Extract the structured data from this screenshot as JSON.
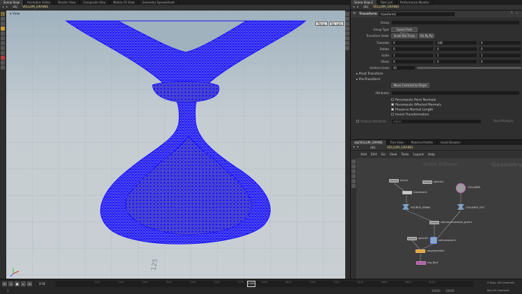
{
  "viewer": {
    "tabs": [
      "Scene View",
      "Animation Editor",
      "Render View",
      "Composite View",
      "Motion FX View",
      "Geometry Spreadsheet"
    ],
    "path": [
      "obj",
      "VELLUM_GRAINS"
    ],
    "view_label": "View",
    "camera_btn": "Persp",
    "cam_btn": "No cam"
  },
  "params": {
    "tabs": [
      "Scene View 2",
      "Take List",
      "Performance Monitor"
    ],
    "path": [
      "obj",
      "VELLUM_GRAINS"
    ],
    "node_type": "Transform",
    "node_name": "transform1",
    "rows": {
      "group_label": "Group",
      "group_type_label": "Group Type",
      "group_type_value": "Guess from Group",
      "xform_order_label": "Transform Order",
      "xform_order_value": "Scale Rot Trans",
      "rot_order_value": "Rx Ry Rz",
      "translate_label": "Translate",
      "translate": [
        "0",
        "148",
        "0"
      ],
      "rotate_label": "Rotate",
      "rotate": [
        "0",
        "0",
        "0"
      ],
      "scale_label": "Scale",
      "scale": [
        "1",
        "1",
        "1"
      ],
      "shear_label": "Shear",
      "shear": [
        "0",
        "0",
        "0"
      ],
      "uniform_label": "Uniform Scale",
      "uniform": "45",
      "pivot_transform": "Pivot Transform",
      "pre_transform": "Pre-Transform",
      "move_centroid_btn": "Move Centroid to Origin",
      "attributes_label": "Attributes",
      "recompute_normals": "Recompute Point Normals",
      "recompute_affected": "Recompute Affected Normals",
      "preserve_normal": "Preserve Normal Length",
      "invert": "Invert Transformation",
      "output_attr_label": "Output Attribute",
      "output_attr_value": "xform",
      "post_multiply": "Post-Multiply"
    }
  },
  "network": {
    "tabs": [
      "obj/VELLUM_GRAINS",
      "Tree View",
      "Material Palette",
      "Asset Browser"
    ],
    "path": [
      "obj",
      "VELLUM_GRAINS"
    ],
    "menu": [
      "Add",
      "Edit",
      "Go",
      "View",
      "Tools",
      "Layout",
      "Help"
    ],
    "watermark_left": "Indie Edition",
    "watermark_right": "Geometry",
    "nodes": [
      {
        "name": "torus1"
      },
      {
        "name": "sphere1"
      },
      {
        "name": "transform1"
      },
      {
        "name": "COLLIDER"
      },
      {
        "name": "SOURCE_GRAIN"
      },
      {
        "name": "COLLIDER_OUT"
      },
      {
        "name": "vellumconstraints_grain1"
      },
      {
        "name": "vellumsolver1"
      },
      {
        "name": "sphere2"
      },
      {
        "name": "copytopoints1"
      },
      {
        "name": "rop_fbx1"
      }
    ]
  },
  "timeline": {
    "frame": "1190",
    "current": "1190",
    "ticks": [
      "1200",
      "1400",
      "1600",
      "1800",
      "2000",
      "2200",
      "2400",
      "2600",
      "2800",
      "3000",
      "3200",
      "3400",
      "3600",
      "3800",
      "4000"
    ],
    "start": "1",
    "end": "10000",
    "end2": "10000",
    "keys_label": "0 keys, 0/0 channels",
    "all_channels": "Key All Channels"
  },
  "grid_label": "125",
  "colors": {
    "wire": "#1a14ff",
    "accent": "#e0b14a"
  }
}
